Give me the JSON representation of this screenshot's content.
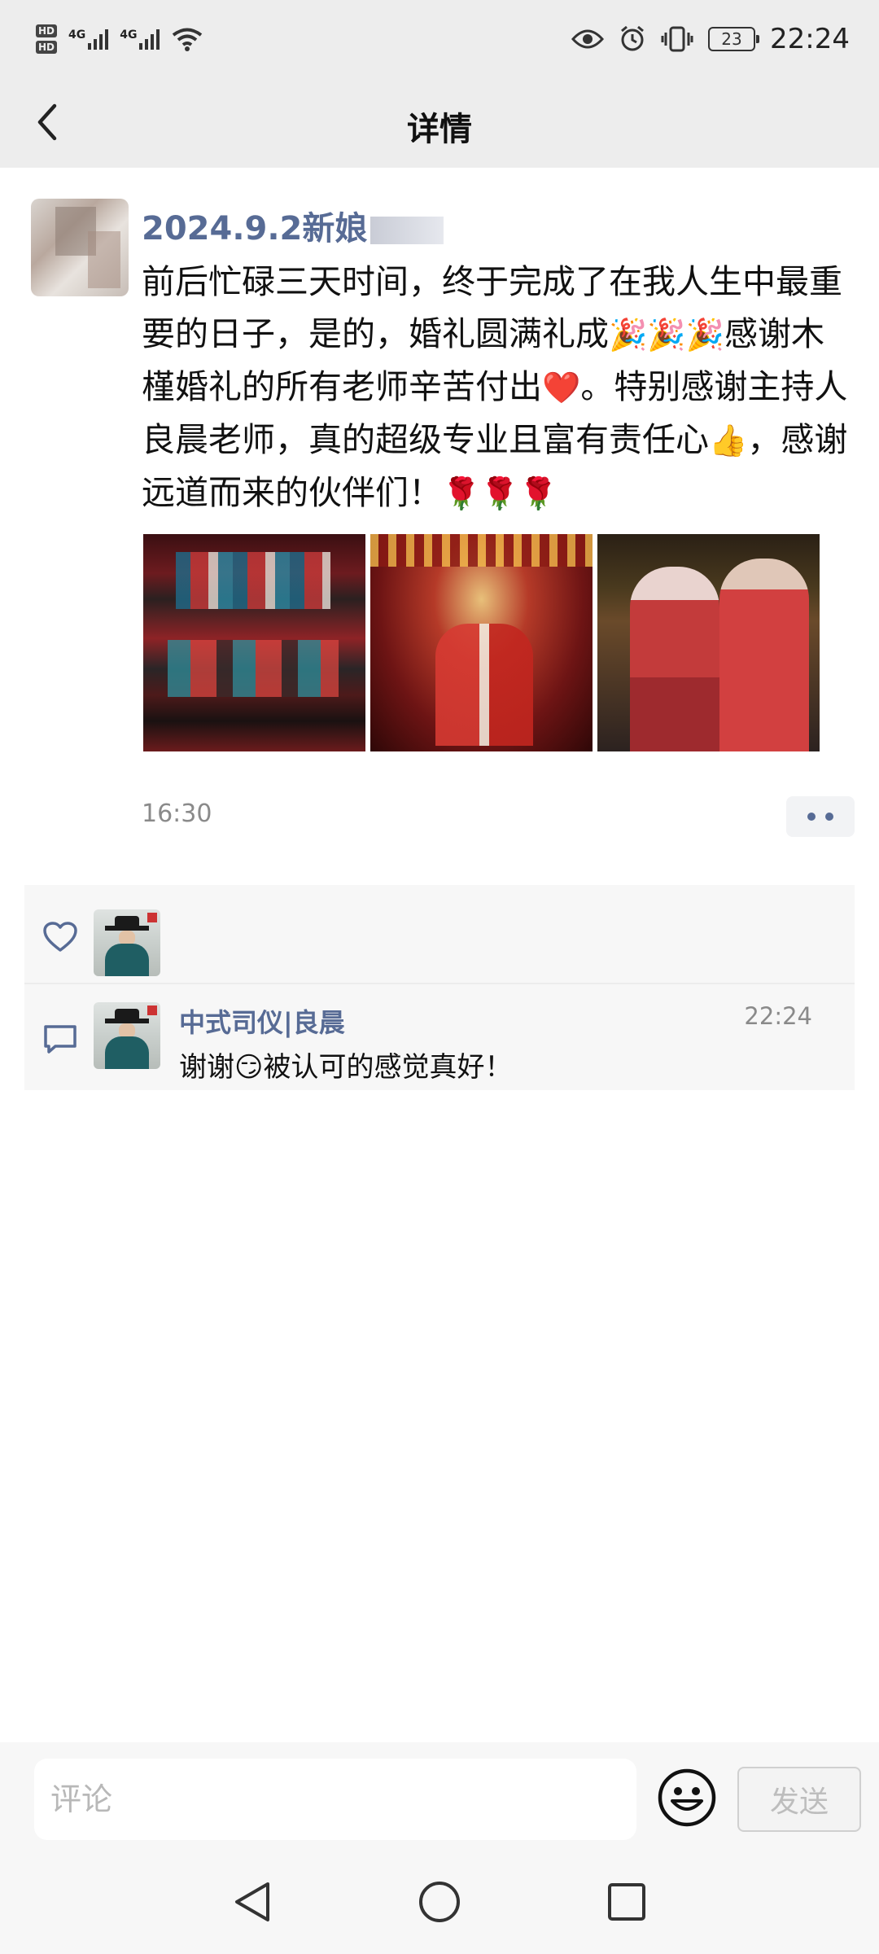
{
  "status_bar": {
    "network_1": "4G",
    "network_2": "4G",
    "hd_1": "HD",
    "hd_2": "HD",
    "battery": "23",
    "time": "22:24",
    "icons": [
      "eye-icon",
      "alarm-icon",
      "vibrate-icon"
    ]
  },
  "header": {
    "title": "详情",
    "back_icon": "chevron-left-icon"
  },
  "post": {
    "author_name": "2024.9.2新娘",
    "text_1": "前后忙碌三天时间，终于完成了在我人生中最重要的日子，是的，婚礼圆满礼成",
    "emoji_party": "🎉🎉🎉",
    "text_2": "感谢木槿婚礼的所有老师辛苦付出",
    "emoji_heart": "❤️",
    "text_3": "。特别感谢主持人良晨老师，真的超级专业且富有责任心",
    "emoji_thumb": "👍",
    "text_4": "，感谢远道而来的伙伴们！",
    "emoji_rose": "🌹🌹🌹",
    "time": "16:30",
    "photos": [
      "photo-1",
      "photo-2",
      "photo-3"
    ]
  },
  "likes": {
    "icon": "heart-outline-icon"
  },
  "comments": [
    {
      "name": "中式司仪|良晨",
      "time": "22:24",
      "text_before": "谢谢",
      "emoji": "😏",
      "text_after": "被认可的感觉真好！"
    }
  ],
  "input_bar": {
    "placeholder": "评论",
    "send_label": "发送"
  },
  "colors": {
    "link_blue": "#576b95",
    "bar_gray": "#ededed",
    "panel_gray": "#f7f7f7"
  }
}
